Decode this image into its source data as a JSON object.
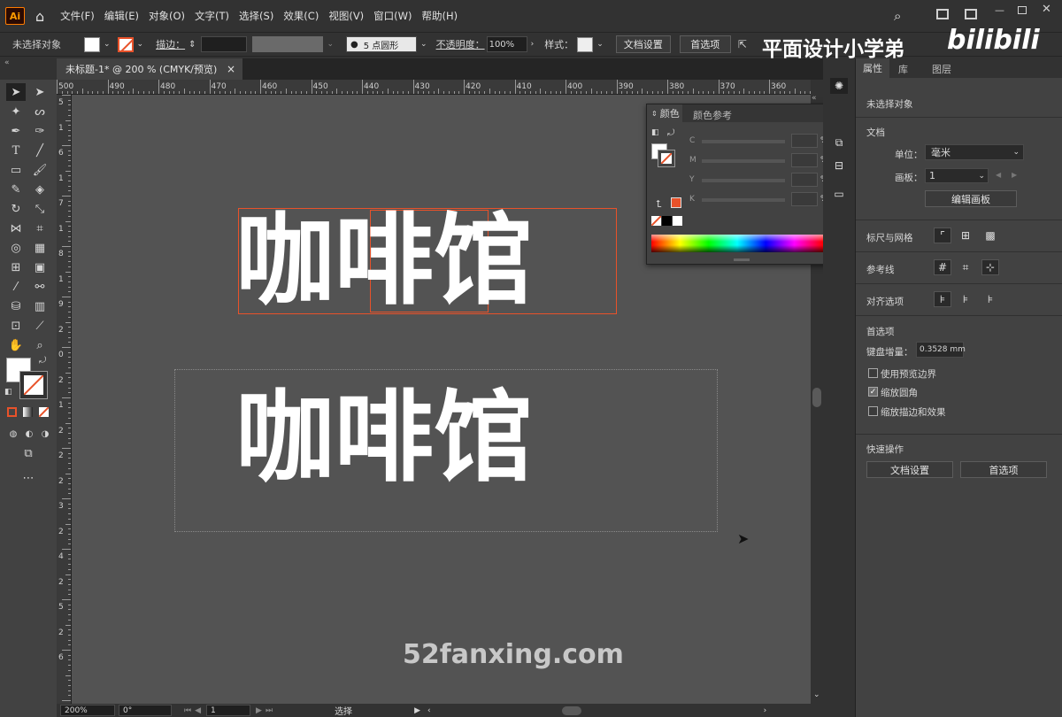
{
  "menubar": {
    "logo": "Ai",
    "items": [
      "文件(F)",
      "编辑(E)",
      "对象(O)",
      "文字(T)",
      "选择(S)",
      "效果(C)",
      "视图(V)",
      "窗口(W)",
      "帮助(H)"
    ]
  },
  "control": {
    "selection": "未选择对象",
    "stroke_label": "描边：",
    "brush": "5 点圆形",
    "opacity_label": "不透明度：",
    "opacity_value": "100%",
    "style_label": "样式：",
    "doc_setup": "文档设置",
    "prefs": "首选项"
  },
  "overlay": {
    "brand": "平面设计小学弟",
    "bili": "bilibili",
    "watermark": "52fanxing.com"
  },
  "tab": {
    "title": "未标题-1* @ 200 % (CMYK/预览)",
    "close": "×"
  },
  "ruler": {
    "h": [
      "500",
      "490",
      "480",
      "470",
      "460",
      "450",
      "440",
      "430",
      "420",
      "410",
      "400",
      "390",
      "380",
      "370",
      "360"
    ],
    "v": [
      "5",
      "1",
      "6",
      "1",
      "7",
      "1",
      "8",
      "1",
      "9",
      "2",
      "0",
      "2",
      "1",
      "2",
      "2",
      "2",
      "3",
      "2",
      "4",
      "2",
      "5",
      "2",
      "6"
    ]
  },
  "canvas": {
    "text_top": "咖啡馆",
    "text_bottom": "咖啡馆"
  },
  "colorpanel": {
    "tab_active": "颜色",
    "tab_other": "颜色参考",
    "channels": [
      "C",
      "M",
      "Y",
      "K"
    ],
    "percent": "%"
  },
  "status": {
    "zoom": "200%",
    "rotate": "0°",
    "artboard": "1",
    "mode": "选择"
  },
  "props": {
    "tabs": [
      "属性",
      "库",
      "图层"
    ],
    "no_selection": "未选择对象",
    "doc_section": "文档",
    "unit_label": "单位：",
    "unit_value": "毫米",
    "artboard_label": "画板：",
    "artboard_value": "1",
    "edit_artboard": "编辑画板",
    "rulers_grid": "标尺与网格",
    "guides": "参考线",
    "snap_options": "对齐选项",
    "prefs_section": "首选项",
    "keyboard_label": "键盘增量：",
    "keyboard_value": "0.3528 mm",
    "chk_preview": "使用预览边界",
    "chk_corners": "缩放圆角",
    "chk_strokes": "缩放描边和效果",
    "quick_actions": "快速操作",
    "doc_setup": "文档设置",
    "prefs": "首选项"
  },
  "colors": {
    "accent": "#e8522a",
    "canvas": "#535353"
  }
}
